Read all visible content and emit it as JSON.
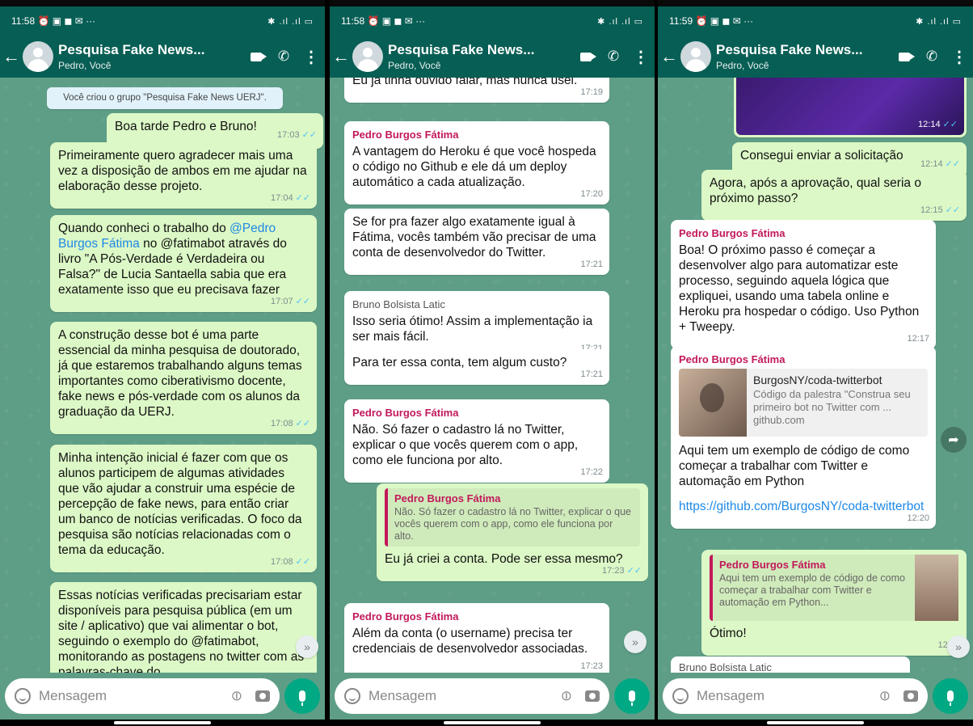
{
  "input": {
    "placeholder": "Mensagem"
  },
  "panels": [
    {
      "status": {
        "time": "11:58",
        "icons": "⏰ ▣ ◼ ✉ ···",
        "right": "✱ .ıl .ıl ▭"
      },
      "header": {
        "title": "Pesquisa Fake News...",
        "subtitle": "Pedro, Você"
      },
      "messages": [
        {
          "system": "Você criou o grupo \"Pesquisa Fake News UERJ\"."
        },
        {
          "text": "Boa tarde Pedro e Bruno!",
          "time": "17:03",
          "ticks": "✓✓"
        },
        {
          "text": "Primeiramente quero agradecer mais uma vez a disposição de ambos em me ajudar na elaboração desse projeto.",
          "time": "17:04",
          "ticks": "✓✓"
        },
        {
          "pre": "Quando conheci o trabalho do ",
          "mention": "@Pedro Burgos Fátima",
          "post": " no @fatimabot através do livro \"A Pós-Verdade é Verdadeira ou Falsa?\" de Lucia Santaella sabia que era exatamente isso que eu precisava fazer",
          "time": "17:07",
          "ticks": "✓✓"
        },
        {
          "text": "A construção desse bot é uma parte essencial da minha pesquisa de doutorado, já que estaremos trabalhando alguns temas importantes como ciberativismo docente, fake news e pós-verdade com os alunos da graduação da UERJ.",
          "time": "17:08",
          "ticks": "✓✓"
        },
        {
          "text": "Minha intenção inicial é fazer com que os alunos participem de algumas atividades que vão ajudar a construir uma espécie de percepção de fake news, para então criar um banco de notícias verificadas. O foco da pesquisa são notícias relacionadas com o tema da educação.",
          "time": "17:08",
          "ticks": "✓✓"
        },
        {
          "text": "Essas notícias verificadas precisariam estar disponíveis para pesquisa pública (em um site / aplicativo) que vai alimentar o bot, seguindo o exemplo do @fatimabot, monitorando as postagens no twitter com as palavras-chave do"
        }
      ]
    },
    {
      "status": {
        "time": "11:58",
        "icons": "⏰ ▣ ◼ ✉ ···",
        "right": "✱ .ıl .ıl ▭"
      },
      "header": {
        "title": "Pesquisa Fake News...",
        "subtitle": "Pedro, Você"
      },
      "messages": [
        {
          "text": "Eu já tinha ouvido falar, mas nunca usei.",
          "time": "17:19"
        },
        {
          "sender": "Pedro Burgos Fátima",
          "text": "A vantagem do Heroku é que você hospeda o código no Github e ele dá um deploy automático a cada atualização.",
          "time": "17:20"
        },
        {
          "text": "Se for pra fazer algo exatamente igual à Fátima, vocês também vão precisar de uma conta de desenvolvedor do Twitter.",
          "time": "17:21"
        },
        {
          "sender": "Bruno Bolsista Latic",
          "text": "Isso seria ótimo! Assim a implementação ia ser mais fácil.",
          "time": "17:21"
        },
        {
          "text": "Para ter essa conta, tem algum custo?",
          "time": "17:21"
        },
        {
          "sender": "Pedro Burgos Fátima",
          "text": "Não. Só fazer o cadastro lá no Twitter, explicar o que vocês querem com o app, como ele funciona por alto.",
          "time": "17:22"
        },
        {
          "quote_name": "Pedro Burgos Fátima",
          "quote_text": "Não. Só fazer o cadastro lá no Twitter, explicar o que vocês querem com o app, como ele funciona por alto.",
          "text": "Eu já criei a conta. Pode ser essa mesmo?",
          "time": "17:23",
          "ticks": "✓✓"
        },
        {
          "sender": "Pedro Burgos Fátima",
          "text": "Além da conta (o username) precisa ter credenciais de desenvolvedor associadas.",
          "time": "17:23"
        }
      ]
    },
    {
      "status": {
        "time": "11:59",
        "icons": "⏰ ▣ ◼ ✉ ···",
        "right": "✱ .ıl .ıl ▭"
      },
      "header": {
        "title": "Pesquisa Fake News...",
        "subtitle": "Pedro, Você"
      },
      "messages": [
        {
          "image_time": "12:14",
          "ticks": "✓✓"
        },
        {
          "text": "Consegui enviar a solicitação",
          "time": "12:14",
          "ticks": "✓✓"
        },
        {
          "text": "Agora, após a aprovação, qual seria o próximo passo?",
          "time": "12:15",
          "ticks": "✓✓"
        },
        {
          "sender": "Pedro Burgos Fátima",
          "text": "Boa! O próximo passo é começar a desenvolver algo para automatizar este processo, seguindo aquela lógica que expliquei, usando uma tabela online e Heroku pra hospedar o código. Uso Python + Tweepy.",
          "time": "12:17"
        },
        {
          "sender": "Pedro Burgos Fátima",
          "preview_title": "BurgosNY/coda-twitterbot",
          "preview_desc": "Código da palestra \"Construa seu primeiro bot no Twitter com ...",
          "preview_domain": "github.com",
          "text": "Aqui tem um exemplo de código de como começar a trabalhar com Twitter e automação em Python",
          "link": "https://github.com/BurgosNY/coda-twitterbot",
          "time": "12:20"
        },
        {
          "quote_name": "Pedro Burgos Fátima",
          "quote_text": "Aqui tem um exemplo de código de como começar a trabalhar com Twitter e automação em Python...",
          "text": "Ótimo!",
          "time": "12:20"
        },
        {
          "sender": "Bruno Bolsista Latic"
        }
      ]
    }
  ]
}
